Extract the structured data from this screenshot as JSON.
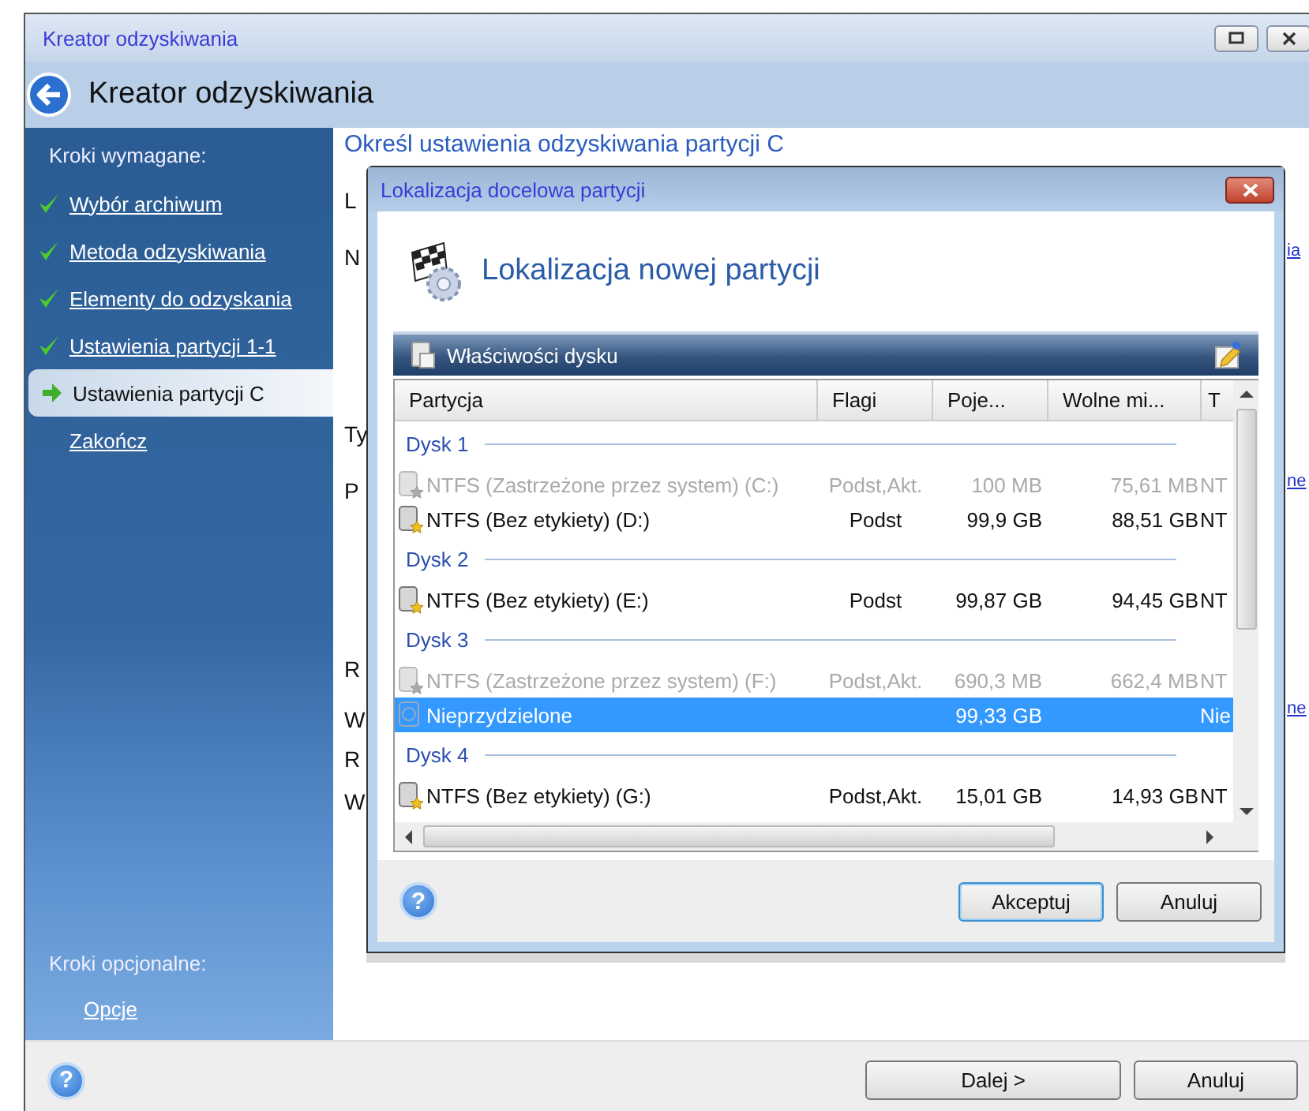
{
  "window": {
    "title": "Kreator odzyskiwania",
    "header": "Kreator odzyskiwania"
  },
  "sidebar": {
    "required_label": "Kroki wymagane:",
    "steps": [
      {
        "label": "Wybór archiwum",
        "kind": "done",
        "selected": false
      },
      {
        "label": "Metoda odzyskiwania",
        "kind": "done",
        "selected": false
      },
      {
        "label": "Elementy do odzyskania",
        "kind": "done",
        "selected": false
      },
      {
        "label": "Ustawienia partycji 1-1",
        "kind": "done",
        "selected": false
      },
      {
        "label": "Ustawienia partycji C",
        "kind": "current",
        "selected": true
      },
      {
        "label": "Zakończ",
        "kind": "pending",
        "selected": false
      }
    ],
    "optional_label": "Kroki opcjonalne:",
    "optional_steps": [
      {
        "label": "Opcje"
      }
    ]
  },
  "content": {
    "heading": "Określ ustawienia odzyskiwania partycji C",
    "left_fragments": [
      "L",
      "N",
      "Ty",
      "P",
      "R",
      "W",
      "R",
      "W"
    ],
    "right_links": [
      "ia",
      "ne",
      "ne"
    ]
  },
  "dialog": {
    "title": "Lokalizacja docelowa partycji",
    "heading": "Lokalizacja nowej partycji",
    "panel_title": "Właściwości dysku",
    "columns": [
      "Partycja",
      "Flagi",
      "Poje...",
      "Wolne mi...",
      "T"
    ],
    "rows": [
      {
        "kind": "disk",
        "label": "Dysk 1"
      },
      {
        "kind": "partition",
        "cells": [
          "NTFS (Zastrzeżone przez system) (C:)",
          "Podst,Akt.",
          "100 MB",
          "75,61 MB",
          "NT"
        ],
        "disabled": true,
        "selected": false
      },
      {
        "kind": "partition",
        "cells": [
          "NTFS (Bez etykiety) (D:)",
          "Podst",
          "99,9 GB",
          "88,51 GB",
          "NT"
        ],
        "disabled": false,
        "selected": false
      },
      {
        "kind": "disk",
        "label": "Dysk 2"
      },
      {
        "kind": "partition",
        "cells": [
          "NTFS (Bez etykiety) (E:)",
          "Podst",
          "99,87 GB",
          "94,45 GB",
          "NT"
        ],
        "disabled": false,
        "selected": false
      },
      {
        "kind": "disk",
        "label": "Dysk 3"
      },
      {
        "kind": "partition",
        "cells": [
          "NTFS (Zastrzeżone przez system) (F:)",
          "Podst,Akt.",
          "690,3 MB",
          "662,4 MB",
          "NT"
        ],
        "disabled": true,
        "selected": false
      },
      {
        "kind": "unallocated",
        "cells": [
          "Nieprzydzielone",
          "",
          "99,33 GB",
          "",
          "Nie"
        ],
        "disabled": false,
        "selected": true
      },
      {
        "kind": "disk",
        "label": "Dysk 4"
      },
      {
        "kind": "partition",
        "cells": [
          "NTFS (Bez etykiety) (G:)",
          "Podst,Akt.",
          "15,01 GB",
          "14,93 GB",
          "NT"
        ],
        "disabled": false,
        "selected": false
      }
    ],
    "help": {
      "glyph": "?"
    },
    "buttons": [
      {
        "label": "Akceptuj",
        "default": true
      },
      {
        "label": "Anuluj",
        "default": false
      }
    ]
  },
  "help": {
    "glyph": "?"
  },
  "buttons": [
    {
      "label": "Dalej >",
      "default": false
    },
    {
      "label": "Anuluj",
      "default": false
    }
  ]
}
